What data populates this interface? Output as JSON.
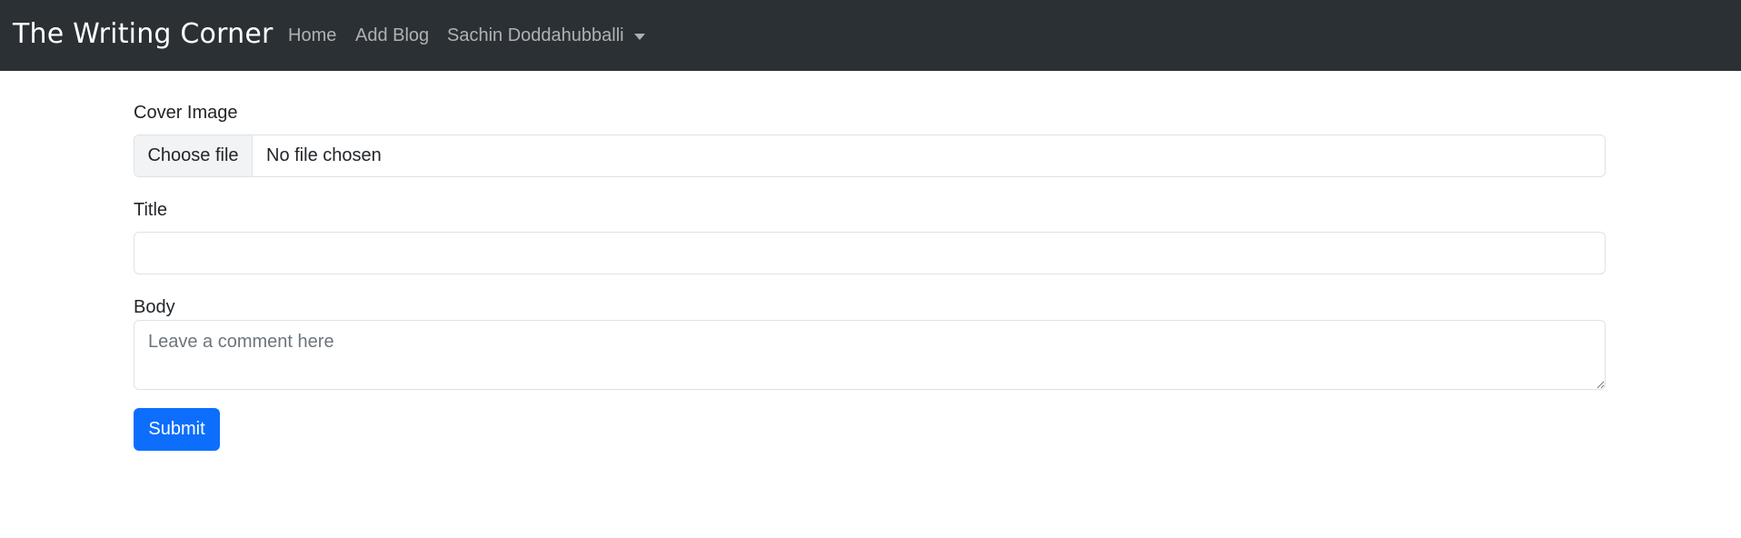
{
  "navbar": {
    "brand": "The Writing Corner",
    "links": [
      "Home",
      "Add Blog"
    ],
    "user_menu": "Sachin Doddahubballi",
    "background": "#2b3035"
  },
  "form": {
    "cover_label": "Cover Image",
    "file_button": "Choose file",
    "file_status": "No file chosen",
    "title_label": "Title",
    "title_value": "",
    "body_label": "Body",
    "body_placeholder": "Leave a comment here",
    "submit_label": "Submit",
    "accent": "#0d6efd"
  }
}
